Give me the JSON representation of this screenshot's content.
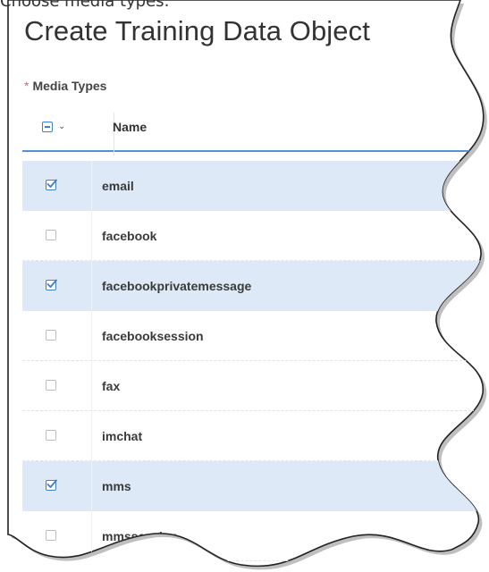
{
  "caption": "Choose media types:",
  "page_title": "Create Training Data Object",
  "field": {
    "required_marker": "*",
    "label": "Media Types"
  },
  "table": {
    "select_all_state": "partial",
    "column_name": "Name",
    "rows": [
      {
        "name": "email",
        "selected": true
      },
      {
        "name": "facebook",
        "selected": false
      },
      {
        "name": "facebookprivatemessage",
        "selected": true
      },
      {
        "name": "facebooksession",
        "selected": false
      },
      {
        "name": "fax",
        "selected": false
      },
      {
        "name": "imchat",
        "selected": false
      },
      {
        "name": "mms",
        "selected": true
      },
      {
        "name": "mmssession",
        "selected": false
      }
    ]
  },
  "colors": {
    "selected_row": "#dde9f7",
    "accent": "#3b7fd0",
    "required": "#e0607a"
  },
  "icons": {
    "header_checkbox": "partial-checkbox-icon",
    "header_menu": "chevron-down-icon",
    "row_checkbox": "checkbox-icon"
  }
}
